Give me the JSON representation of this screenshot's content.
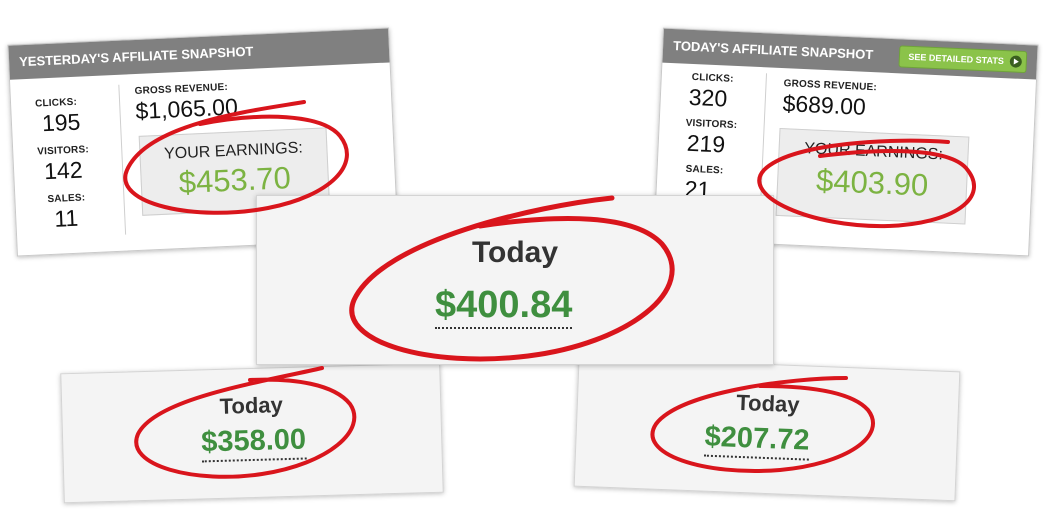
{
  "yesterday": {
    "title": "YESTERDAY'S AFFILIATE SNAPSHOT",
    "clicks_label": "CLICKS:",
    "clicks": "195",
    "visitors_label": "VISITORS:",
    "visitors": "142",
    "sales_label": "SALES:",
    "sales": "11",
    "gross_label": "GROSS REVENUE:",
    "gross": "$1,065.00",
    "earnings_label": "YOUR EARNINGS:",
    "earnings": "$453.70"
  },
  "today_snapshot": {
    "title": "TODAY'S AFFILIATE SNAPSHOT",
    "stats_button": "SEE DETAILED STATS",
    "clicks_label": "CLICKS:",
    "clicks": "320",
    "visitors_label": "VISITORS:",
    "visitors": "219",
    "sales_label": "SALES:",
    "sales": "21",
    "gross_label": "GROSS REVENUE:",
    "gross": "$689.00",
    "earnings_label": "YOUR EARNINGS:",
    "earnings": "$403.90"
  },
  "today_cards": {
    "center": {
      "title": "Today",
      "amount": "$400.84"
    },
    "left": {
      "title": "Today",
      "amount": "$358.00"
    },
    "right": {
      "title": "Today",
      "amount": "$207.72"
    }
  },
  "colors": {
    "earnings_green": "#7cb342",
    "amount_green": "#3f8f3f",
    "circle_red": "#d9151c",
    "header_gray": "#808080",
    "button_green": "#8bc34a"
  }
}
